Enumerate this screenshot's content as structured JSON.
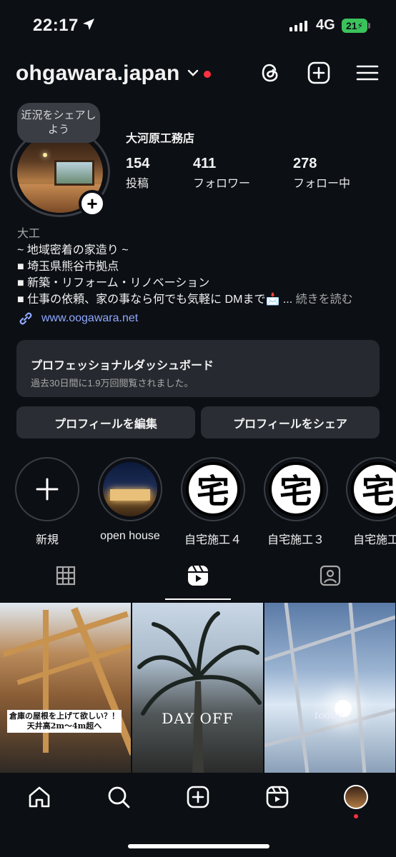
{
  "status_bar": {
    "time": "22:17",
    "network": "4G",
    "battery": "21"
  },
  "header": {
    "username": "ohgawara.japan"
  },
  "profile": {
    "note_bubble": "近況をシェアしよう",
    "display_name": "大河原工務店",
    "stats": [
      {
        "value": "154",
        "label": "投稿"
      },
      {
        "value": "411",
        "label": "フォロワー"
      },
      {
        "value": "278",
        "label": "フォロー中"
      }
    ],
    "bio": {
      "category": "大工",
      "line1": "~ 地域密着の家造り ~",
      "line2": "■ 埼玉県熊谷市拠点",
      "line3": "■ 新築・リフォーム・リノベーション",
      "line4": "■ 仕事の依頼、家の事なら何でも気軽に DMまで📩 ...",
      "more": "続きを読む"
    },
    "link": "www.oogawara.net"
  },
  "dashboard": {
    "title": "プロフェッショナルダッシュボード",
    "subtitle": "過去30日間に1.9万回閲覧されました。"
  },
  "buttons": {
    "edit": "プロフィールを編集",
    "share": "プロフィールをシェア"
  },
  "highlights": [
    {
      "label": "新規"
    },
    {
      "label": "open house"
    },
    {
      "label": "自宅施工４",
      "glyph": "宅"
    },
    {
      "label": "自宅施工３",
      "glyph": "宅"
    },
    {
      "label": "自宅施工",
      "glyph": "宅"
    }
  ],
  "grid": {
    "post1_caption_line1": "倉庫の屋根を上げて欲しい？！",
    "post1_caption_line2": "天井高2m〜4m超へ",
    "post2_text": "DAY OFF",
    "post3_text": "today"
  }
}
